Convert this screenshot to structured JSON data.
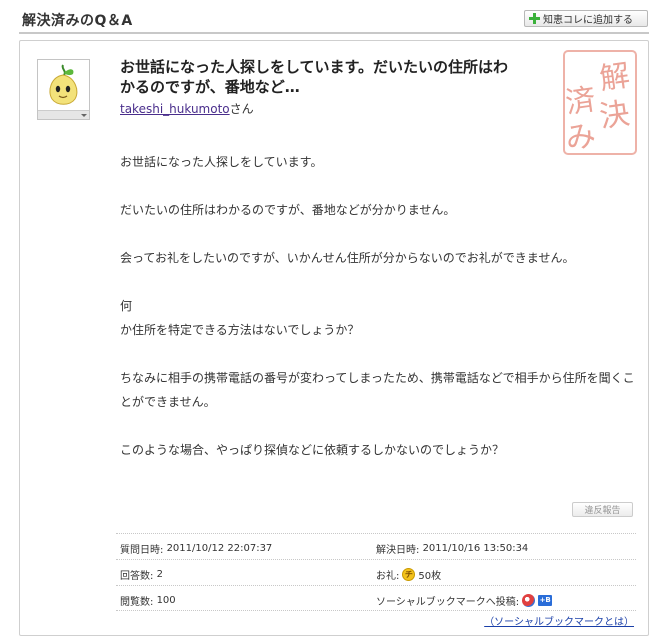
{
  "header": {
    "title": "解決済みのQ＆A",
    "add_button_label": "知恵コレに追加する"
  },
  "question": {
    "title": "お世話になった人探しをしています。だいたいの住所はわかるのですが、番地など…",
    "user_name": "takeshi_hukumoto",
    "user_suffix": "さん",
    "paragraphs": [
      "お世話になった人探しをしています。",
      "だいたいの住所はわかるのですが、番地などが分かりません。",
      "会ってお礼をしたいのですが、いかんせん住所が分からないのでお礼ができません。",
      "何\nか住所を特定できる方法はないでしょうか？",
      "ちなみに相手の携帯電話の番号が変わってしまったため、携帯電話などで相手から住所を聞くことができません。",
      "このような場合、やっぱり探偵などに依頼するしかないのでしょうか？"
    ],
    "stamp_text": "解決済み"
  },
  "report_button_label": "違反報告",
  "meta": {
    "asked_label": "質問日時:",
    "asked_value": "2011/10/12 22:07:37",
    "resolved_label": "解決日時:",
    "resolved_value": "2011/10/16 13:50:34",
    "answers_label": "回答数:",
    "answers_value": "2",
    "reward_label": "お礼:",
    "reward_icon": "chie-coin-icon",
    "reward_value": "50枚",
    "views_label": "閲覧数:",
    "views_value": "100",
    "social_label": "ソーシャルブックマークへ投稿:",
    "social_icons": [
      "bookmark-service-icon",
      "hatena-bookmark-icon"
    ]
  },
  "social_link": "（ソーシャルブックマークとは）",
  "colors": {
    "link": "#4a2e8c",
    "stamp": "#e08070",
    "plus": "#3bb13b",
    "coin": "#f3c21b"
  }
}
